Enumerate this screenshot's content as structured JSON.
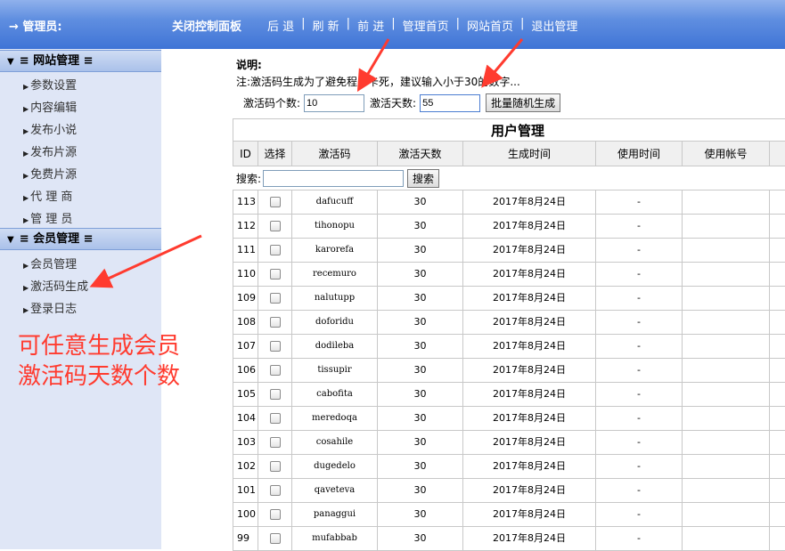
{
  "topbar": {
    "admin": "→ 管理员:",
    "panel": "关闭控制面板",
    "nav": [
      {
        "label": "后 退"
      },
      {
        "label": "刷 新"
      },
      {
        "label": "前 进"
      },
      {
        "label": "管理首页"
      },
      {
        "label": "网站首页"
      },
      {
        "label": "退出管理"
      }
    ]
  },
  "sidebar": {
    "site_section": "网站管理",
    "site_items": [
      "参数设置",
      "内容编辑",
      "发布小说",
      "发布片源",
      "免费片源",
      "代 理 商",
      "管 理 员"
    ],
    "member_section": "会员管理",
    "member_items": [
      "会员管理",
      "激活码生成",
      "登录日志"
    ]
  },
  "note": {
    "title": "说明:",
    "text": "注:激活码生成为了避免程序卡死，建议输入小于30的数字..."
  },
  "form": {
    "count_label": "激活码个数:",
    "count_value": "10",
    "days_label": "激活天数:",
    "days_value": "55",
    "generate_button": "批量随机生成"
  },
  "table": {
    "title": "用户管理",
    "headers": [
      "ID",
      "选择",
      "激活码",
      "激活天数",
      "生成时间",
      "使用时间",
      "使用帐号"
    ],
    "search_label": "搜索:",
    "search_button": "搜索",
    "rows": [
      {
        "id": "113",
        "code": "dafucuff",
        "days": "30",
        "gen": "2017年8月24日",
        "used": "-"
      },
      {
        "id": "112",
        "code": "tihonopu",
        "days": "30",
        "gen": "2017年8月24日",
        "used": "-"
      },
      {
        "id": "111",
        "code": "karorefa",
        "days": "30",
        "gen": "2017年8月24日",
        "used": "-"
      },
      {
        "id": "110",
        "code": "recemuro",
        "days": "30",
        "gen": "2017年8月24日",
        "used": "-"
      },
      {
        "id": "109",
        "code": "nalutupp",
        "days": "30",
        "gen": "2017年8月24日",
        "used": "-"
      },
      {
        "id": "108",
        "code": "doforidu",
        "days": "30",
        "gen": "2017年8月24日",
        "used": "-"
      },
      {
        "id": "107",
        "code": "dodileba",
        "days": "30",
        "gen": "2017年8月24日",
        "used": "-"
      },
      {
        "id": "106",
        "code": "tissupir",
        "days": "30",
        "gen": "2017年8月24日",
        "used": "-"
      },
      {
        "id": "105",
        "code": "cabofita",
        "days": "30",
        "gen": "2017年8月24日",
        "used": "-"
      },
      {
        "id": "104",
        "code": "meredoqa",
        "days": "30",
        "gen": "2017年8月24日",
        "used": "-"
      },
      {
        "id": "103",
        "code": "cosahile",
        "days": "30",
        "gen": "2017年8月24日",
        "used": "-"
      },
      {
        "id": "102",
        "code": "dugedelo",
        "days": "30",
        "gen": "2017年8月24日",
        "used": "-"
      },
      {
        "id": "101",
        "code": "qaveteva",
        "days": "30",
        "gen": "2017年8月24日",
        "used": "-"
      },
      {
        "id": "100",
        "code": "panaggui",
        "days": "30",
        "gen": "2017年8月24日",
        "used": "-"
      },
      {
        "id": "99",
        "code": "mufabbab",
        "days": "30",
        "gen": "2017年8月24日",
        "used": "-"
      }
    ]
  },
  "annotation": {
    "line1": "可任意生成会员",
    "line2": "激活码天数个数",
    "color": "#ff3b2f"
  }
}
